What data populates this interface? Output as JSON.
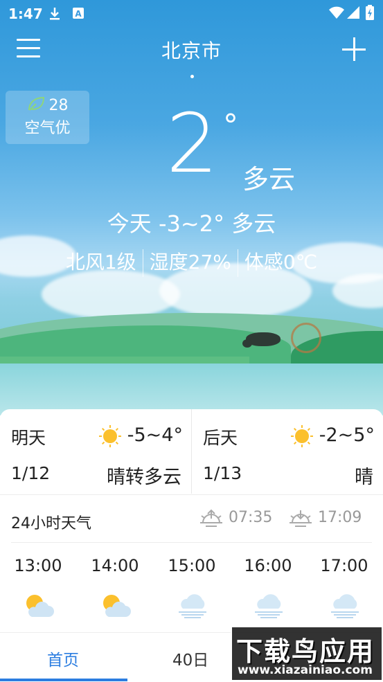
{
  "status_bar": {
    "time": "1:47"
  },
  "header": {
    "city": "北京市"
  },
  "air_quality": {
    "value": "28",
    "label": "空气优"
  },
  "current": {
    "temperature": "2",
    "degree_symbol": "°",
    "condition": "多云",
    "today_summary": "今天 -3~2° 多云",
    "wind": "北风1级",
    "humidity": "湿度27%",
    "feels_like": "体感0℃"
  },
  "forecast": [
    {
      "day": "明天",
      "range": "-5~4°",
      "date": "1/12",
      "condition": "晴转多云"
    },
    {
      "day": "后天",
      "range": "-2~5°",
      "date": "1/13",
      "condition": "晴"
    }
  ],
  "hourly": {
    "title": "24小时天气",
    "sunrise": "07:35",
    "sunset": "17:09",
    "hours": [
      {
        "time": "13:00",
        "icon": "partly-cloudy-icon"
      },
      {
        "time": "14:00",
        "icon": "partly-cloudy-icon"
      },
      {
        "time": "15:00",
        "icon": "haze-cloud-icon"
      },
      {
        "time": "16:00",
        "icon": "haze-cloud-icon"
      },
      {
        "time": "17:00",
        "icon": "haze-cloud-icon"
      }
    ]
  },
  "tabs": {
    "home": "首页",
    "forty_day": "40日"
  },
  "watermark": {
    "main": "下载鸟应用",
    "sub": "www.xiazainiao.com"
  },
  "colors": {
    "accent": "#2b7de0",
    "sky_top": "#2f98da",
    "sun": "#fbc02d"
  }
}
